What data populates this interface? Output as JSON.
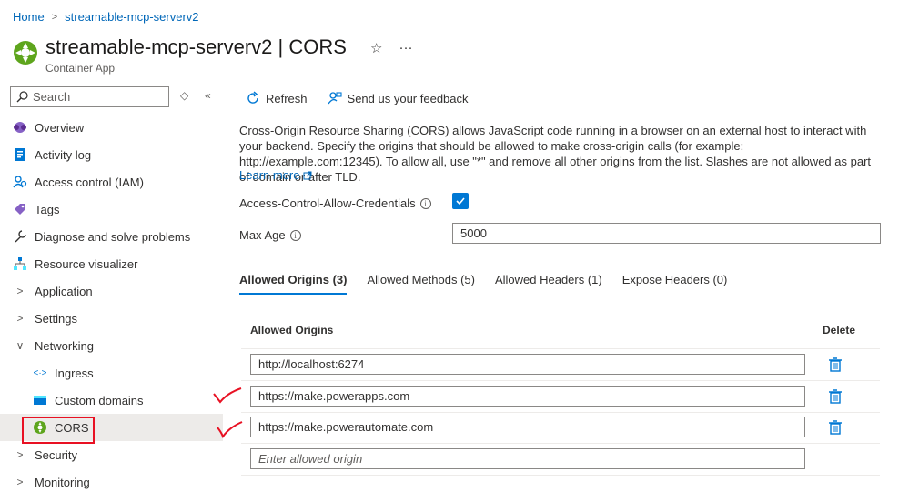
{
  "breadcrumb": {
    "home": "Home",
    "resource": "streamable-mcp-serverv2"
  },
  "header": {
    "title": "streamable-mcp-serverv2 | CORS",
    "subtitle": "Container App",
    "favorite_icon": "star-icon",
    "more_label": "···"
  },
  "sidebar": {
    "search_placeholder": "Search",
    "items": [
      {
        "label": "Overview",
        "icon": "overview-icon"
      },
      {
        "label": "Activity log",
        "icon": "activity-log-icon"
      },
      {
        "label": "Access control (IAM)",
        "icon": "iam-icon"
      },
      {
        "label": "Tags",
        "icon": "tag-icon"
      },
      {
        "label": "Diagnose and solve problems",
        "icon": "wrench-icon"
      },
      {
        "label": "Resource visualizer",
        "icon": "visualizer-icon"
      },
      {
        "label": "Application",
        "icon": "chevron-right-icon"
      },
      {
        "label": "Settings",
        "icon": "chevron-right-icon"
      },
      {
        "label": "Networking",
        "icon": "chevron-down-icon"
      },
      {
        "label": "Ingress",
        "icon": "ingress-icon"
      },
      {
        "label": "Custom domains",
        "icon": "custom-domain-icon"
      },
      {
        "label": "CORS",
        "icon": "cors-icon"
      },
      {
        "label": "Security",
        "icon": "chevron-right-icon"
      },
      {
        "label": "Monitoring",
        "icon": "chevron-right-icon"
      }
    ]
  },
  "toolbar": {
    "refresh_label": "Refresh",
    "feedback_label": "Send us your feedback"
  },
  "content": {
    "description": "Cross-Origin Resource Sharing (CORS) allows JavaScript code running in a browser on an external host to interact with your backend. Specify the origins that should be allowed to make cross-origin calls (for example: http://example.com:12345). To allow all, use \"*\" and remove all other origins from the list. Slashes are not allowed as part of domain or after TLD.",
    "learn_more": "Learn more",
    "allow_credentials_label": "Access-Control-Allow-Credentials",
    "allow_credentials_checked": true,
    "max_age_label": "Max Age",
    "max_age_value": "5000"
  },
  "tabs": [
    {
      "label": "Allowed Origins (3)",
      "active": true
    },
    {
      "label": "Allowed Methods (5)",
      "active": false
    },
    {
      "label": "Allowed Headers (1)",
      "active": false
    },
    {
      "label": "Expose Headers (0)",
      "active": false
    }
  ],
  "origins_table": {
    "col_origins": "Allowed Origins",
    "col_delete": "Delete",
    "rows": [
      {
        "value": "http://localhost:6274"
      },
      {
        "value": "https://make.powerapps.com"
      },
      {
        "value": "https://make.powerautomate.com"
      }
    ],
    "new_placeholder": "Enter allowed origin"
  },
  "colors": {
    "accent": "#0078d4",
    "link": "#0067b8",
    "annotation": "#e81123"
  }
}
